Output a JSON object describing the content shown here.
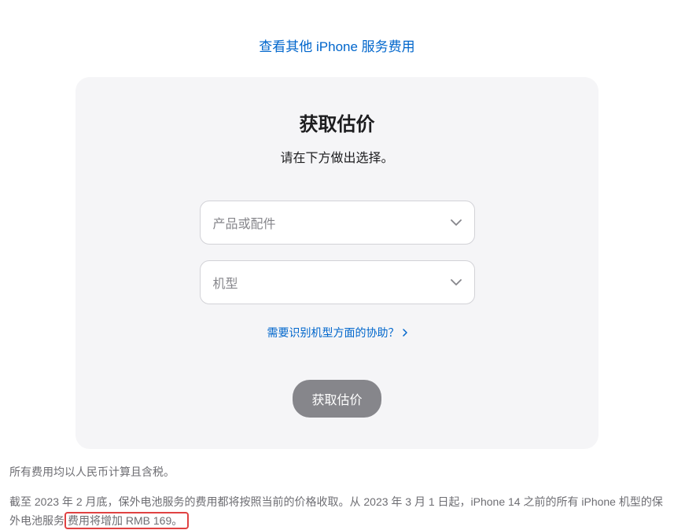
{
  "topLink": {
    "label": "查看其他 iPhone 服务费用"
  },
  "card": {
    "title": "获取估价",
    "subtitle": "请在下方做出选择。",
    "select1": {
      "placeholder": "产品或配件"
    },
    "select2": {
      "placeholder": "机型"
    },
    "helpLink": {
      "label": "需要识别机型方面的协助？"
    },
    "submit": {
      "label": "获取估价"
    }
  },
  "footer": {
    "line1": "所有费用均以人民币计算且含税。",
    "line2_pre": "截至 2023 年 2 月底，保外电池服务的费用都将按照当前的价格收取。从 2023 年 3 月 1 日起，iPhone 14 之前的所有 iPhone 机型的保外电池服务",
    "line2_highlight": "费用将增加 RMB 169。"
  }
}
